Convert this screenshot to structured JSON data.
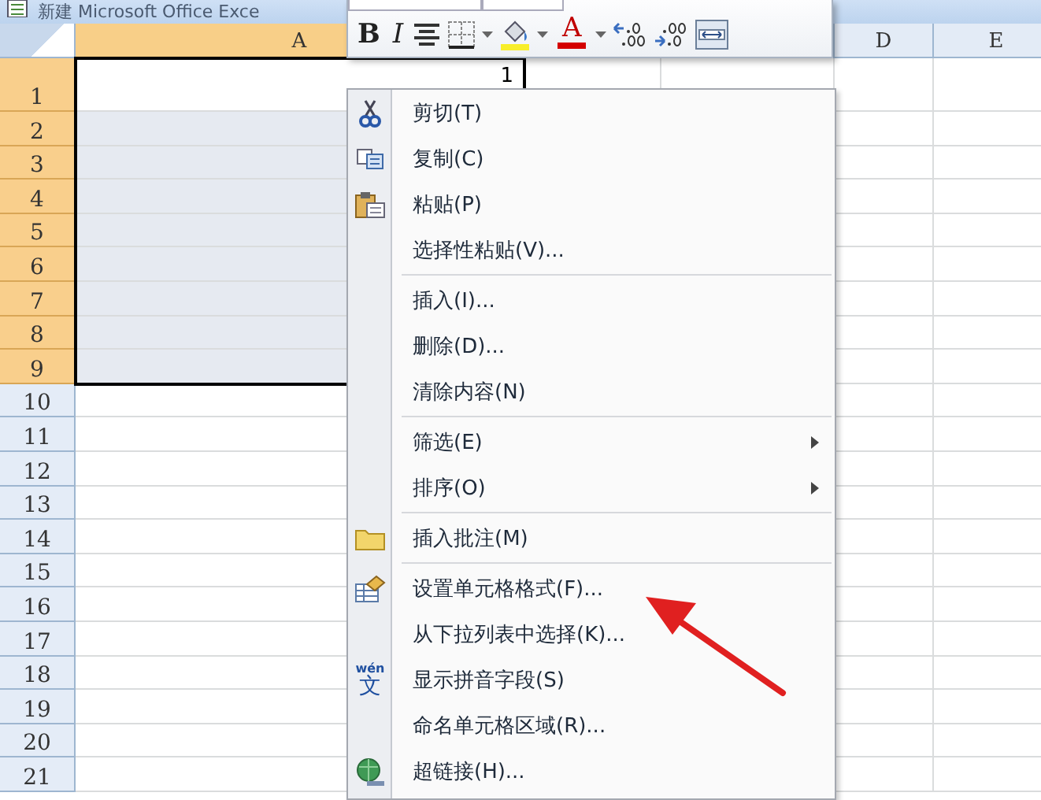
{
  "window": {
    "title": "新建 Microsoft Office Exce"
  },
  "sheet": {
    "columns": [
      {
        "label": "A",
        "selected": true
      },
      {},
      {},
      {
        "label": "D",
        "selected": false
      },
      {
        "label": "E",
        "selected": false
      }
    ],
    "rows": [
      {
        "label": "1",
        "selected": true,
        "values": [
          "1"
        ]
      },
      {
        "label": "2",
        "selected": true
      },
      {
        "label": "3",
        "selected": true
      },
      {
        "label": "4",
        "selected": true
      },
      {
        "label": "5",
        "selected": true
      },
      {
        "label": "6",
        "selected": true
      },
      {
        "label": "7",
        "selected": true
      },
      {
        "label": "8",
        "selected": true
      },
      {
        "label": "9",
        "selected": true
      },
      {
        "label": "10",
        "selected": false
      },
      {
        "label": "11",
        "selected": false
      },
      {
        "label": "12",
        "selected": false
      },
      {
        "label": "13",
        "selected": false
      },
      {
        "label": "14",
        "selected": false
      },
      {
        "label": "15",
        "selected": false
      },
      {
        "label": "16",
        "selected": false
      },
      {
        "label": "17",
        "selected": false
      },
      {
        "label": "18",
        "selected": false
      },
      {
        "label": "19",
        "selected": false
      },
      {
        "label": "20",
        "selected": false
      },
      {
        "label": "21",
        "selected": false
      }
    ]
  },
  "mini_toolbar": {
    "bold": "B",
    "italic": "I",
    "font_color": "A"
  },
  "context_menu": {
    "items": [
      {
        "kind": "item",
        "label": "剪切(T)",
        "submenu": false
      },
      {
        "kind": "item",
        "label": "复制(C)",
        "submenu": false
      },
      {
        "kind": "item",
        "label": "粘贴(P)",
        "submenu": false
      },
      {
        "kind": "item",
        "label": "选择性粘贴(V)...",
        "submenu": false
      },
      {
        "kind": "separator"
      },
      {
        "kind": "item",
        "label": "插入(I)...",
        "submenu": false
      },
      {
        "kind": "item",
        "label": "删除(D)...",
        "submenu": false
      },
      {
        "kind": "item",
        "label": "清除内容(N)",
        "submenu": false
      },
      {
        "kind": "separator"
      },
      {
        "kind": "item",
        "label": "筛选(E)",
        "submenu": true
      },
      {
        "kind": "item",
        "label": "排序(O)",
        "submenu": true
      },
      {
        "kind": "separator"
      },
      {
        "kind": "item",
        "label": "插入批注(M)",
        "submenu": false
      },
      {
        "kind": "separator"
      },
      {
        "kind": "item",
        "label": "设置单元格格式(F)...",
        "submenu": false
      },
      {
        "kind": "item",
        "label": "从下拉列表中选择(K)...",
        "submenu": false
      },
      {
        "kind": "item",
        "label": "显示拼音字段(S)",
        "submenu": false,
        "glyph_top": "wén",
        "glyph": "文"
      },
      {
        "kind": "item",
        "label": "命名单元格区域(R)...",
        "submenu": false
      },
      {
        "kind": "item",
        "label": "超链接(H)...",
        "submenu": false
      }
    ]
  }
}
